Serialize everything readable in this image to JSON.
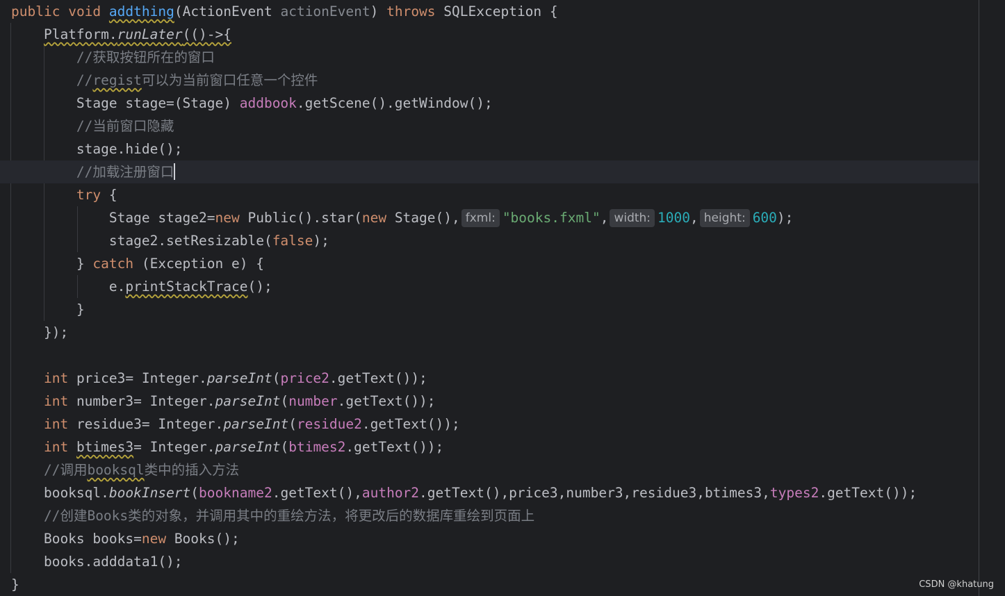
{
  "editor": {
    "watermark": "CSDN @khatung",
    "colors": {
      "background": "#1e1f22",
      "keyword": "#cf8e6d",
      "function": "#56a8f5",
      "field": "#c77dbb",
      "string": "#6aab73",
      "number": "#2aacb8",
      "comment": "#7a7e85",
      "text": "#bcbec4"
    },
    "lines": [
      {
        "tokens": [
          {
            "t": "public",
            "c": "k"
          },
          {
            "t": " "
          },
          {
            "t": "void",
            "c": "k"
          },
          {
            "t": " "
          },
          {
            "t": "addthing",
            "c": "f w"
          },
          {
            "t": "(ActionEvent "
          },
          {
            "t": "actionEvent",
            "c": "p"
          },
          {
            "t": ") "
          },
          {
            "t": "throws",
            "c": "k"
          },
          {
            "t": " SQLException {"
          }
        ]
      },
      {
        "tokens": [
          {
            "t": "    "
          },
          {
            "t": "Platform.",
            "c": "w"
          },
          {
            "t": "runLater",
            "c": "i w"
          },
          {
            "t": "(()->{",
            "c": "w"
          }
        ]
      },
      {
        "tokens": [
          {
            "t": "        "
          },
          {
            "t": "//获取按钮所在的窗口",
            "c": "c"
          }
        ]
      },
      {
        "tokens": [
          {
            "t": "        "
          },
          {
            "t": "//",
            "c": "c"
          },
          {
            "t": "regist",
            "c": "c w"
          },
          {
            "t": "可以为当前窗口任意一个控件",
            "c": "c"
          }
        ]
      },
      {
        "tokens": [
          {
            "t": "        Stage stage=(Stage) "
          },
          {
            "t": "addbook",
            "c": "fd"
          },
          {
            "t": ".getScene().getWindow();"
          }
        ]
      },
      {
        "tokens": [
          {
            "t": "        "
          },
          {
            "t": "//当前窗口隐藏",
            "c": "c"
          }
        ]
      },
      {
        "tokens": [
          {
            "t": "        stage.hide();"
          }
        ]
      },
      {
        "current": true,
        "caret": true,
        "tokens": [
          {
            "t": "        "
          },
          {
            "t": "//加载注册窗口",
            "c": "c"
          }
        ]
      },
      {
        "tokens": [
          {
            "t": "        "
          },
          {
            "t": "try",
            "c": "k"
          },
          {
            "t": " {"
          }
        ]
      },
      {
        "tokens": [
          {
            "t": "            Stage stage2="
          },
          {
            "t": "new",
            "c": "k"
          },
          {
            "t": " Public().star("
          },
          {
            "t": "new",
            "c": "k"
          },
          {
            "t": " Stage(),"
          },
          {
            "hint": "fxml:"
          },
          {
            "t": "\"books.fxml\"",
            "c": "s"
          },
          {
            "t": ","
          },
          {
            "hint": "width:"
          },
          {
            "t": "1000",
            "c": "num"
          },
          {
            "t": ","
          },
          {
            "hint": "height:"
          },
          {
            "t": "600",
            "c": "num"
          },
          {
            "t": ");"
          }
        ]
      },
      {
        "tokens": [
          {
            "t": "            stage2.setResizable("
          },
          {
            "t": "false",
            "c": "k"
          },
          {
            "t": ");"
          }
        ]
      },
      {
        "tokens": [
          {
            "t": "        } "
          },
          {
            "t": "catch",
            "c": "k"
          },
          {
            "t": " (Exception e) {"
          }
        ]
      },
      {
        "tokens": [
          {
            "t": "            e."
          },
          {
            "t": "printStackTrace",
            "c": "w"
          },
          {
            "t": "();"
          }
        ]
      },
      {
        "tokens": [
          {
            "t": "        }"
          }
        ]
      },
      {
        "tokens": [
          {
            "t": "    });"
          }
        ]
      },
      {
        "tokens": []
      },
      {
        "tokens": [
          {
            "t": "    "
          },
          {
            "t": "int",
            "c": "k"
          },
          {
            "t": " price3= Integer."
          },
          {
            "t": "parseInt",
            "c": "i"
          },
          {
            "t": "("
          },
          {
            "t": "price2",
            "c": "fd"
          },
          {
            "t": ".getText());"
          }
        ]
      },
      {
        "tokens": [
          {
            "t": "    "
          },
          {
            "t": "int",
            "c": "k"
          },
          {
            "t": " number3= Integer."
          },
          {
            "t": "parseInt",
            "c": "i"
          },
          {
            "t": "("
          },
          {
            "t": "number",
            "c": "fd"
          },
          {
            "t": ".getText());"
          }
        ]
      },
      {
        "tokens": [
          {
            "t": "    "
          },
          {
            "t": "int",
            "c": "k"
          },
          {
            "t": " residue3= Integer."
          },
          {
            "t": "parseInt",
            "c": "i"
          },
          {
            "t": "("
          },
          {
            "t": "residue2",
            "c": "fd"
          },
          {
            "t": ".getText());"
          }
        ]
      },
      {
        "tokens": [
          {
            "t": "    "
          },
          {
            "t": "int",
            "c": "k"
          },
          {
            "t": " "
          },
          {
            "t": "btimes3",
            "c": "w"
          },
          {
            "t": "= Integer."
          },
          {
            "t": "parseInt",
            "c": "i"
          },
          {
            "t": "("
          },
          {
            "t": "btimes2",
            "c": "fd"
          },
          {
            "t": ".getText());"
          }
        ]
      },
      {
        "tokens": [
          {
            "t": "    "
          },
          {
            "t": "//调用",
            "c": "c"
          },
          {
            "t": "booksql",
            "c": "c w"
          },
          {
            "t": "类中的插入方法",
            "c": "c"
          }
        ]
      },
      {
        "tokens": [
          {
            "t": "    booksql."
          },
          {
            "t": "bookInsert",
            "c": "i"
          },
          {
            "t": "("
          },
          {
            "t": "bookname2",
            "c": "fd"
          },
          {
            "t": ".getText(),"
          },
          {
            "t": "author2",
            "c": "fd"
          },
          {
            "t": ".getText(),price3,number3,residue3,btimes3,"
          },
          {
            "t": "types2",
            "c": "fd"
          },
          {
            "t": ".getText());"
          }
        ]
      },
      {
        "tokens": [
          {
            "t": "    "
          },
          {
            "t": "//创建Books类的对象，并调用其中的重绘方法，将更改后的数据库重绘到页面上",
            "c": "c"
          }
        ]
      },
      {
        "tokens": [
          {
            "t": "    Books books="
          },
          {
            "t": "new",
            "c": "k"
          },
          {
            "t": " Books();"
          }
        ]
      },
      {
        "tokens": [
          {
            "t": "    books.adddata1();"
          }
        ]
      },
      {
        "tokens": [
          {
            "t": "}"
          }
        ]
      }
    ]
  }
}
